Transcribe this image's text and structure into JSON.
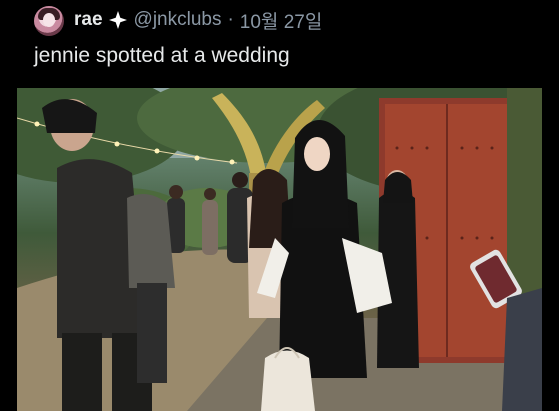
{
  "tweet": {
    "display_name": "rae",
    "badge_icon": "sparkle-icon",
    "handle": "@jnkclubs",
    "separator": "·",
    "date": "10월 27일",
    "text": "jennie spotted at a wedding"
  },
  "media": {
    "type": "photo"
  }
}
